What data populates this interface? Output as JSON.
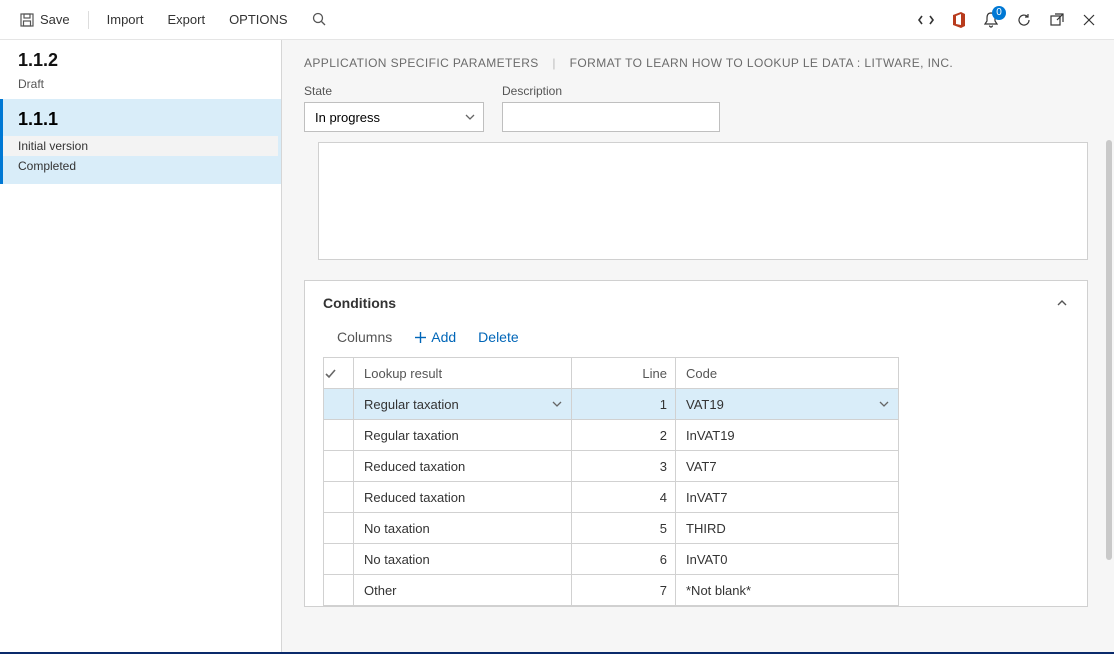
{
  "toolbar": {
    "save": "Save",
    "import": "Import",
    "export": "Export",
    "options": "OPTIONS"
  },
  "notification_count": "0",
  "sidebar": {
    "items": [
      {
        "version": "1.1.2",
        "status": "Draft"
      },
      {
        "version": "1.1.1",
        "desc": "Initial version",
        "status": "Completed"
      }
    ]
  },
  "breadcrumb": {
    "a": "APPLICATION SPECIFIC PARAMETERS",
    "b": "FORMAT TO LEARN HOW TO LOOKUP LE DATA : LITWARE, INC."
  },
  "form": {
    "state_label": "State",
    "state_value": "In progress",
    "desc_label": "Description",
    "desc_value": ""
  },
  "conditions": {
    "title": "Conditions",
    "columns_label": "Columns",
    "add_label": "Add",
    "delete_label": "Delete",
    "headers": {
      "lookup": "Lookup result",
      "line": "Line",
      "code": "Code"
    },
    "rows": [
      {
        "lookup": "Regular taxation",
        "line": "1",
        "code": "VAT19"
      },
      {
        "lookup": "Regular taxation",
        "line": "2",
        "code": "InVAT19"
      },
      {
        "lookup": "Reduced taxation",
        "line": "3",
        "code": "VAT7"
      },
      {
        "lookup": "Reduced taxation",
        "line": "4",
        "code": "InVAT7"
      },
      {
        "lookup": "No taxation",
        "line": "5",
        "code": "THIRD"
      },
      {
        "lookup": "No taxation",
        "line": "6",
        "code": "InVAT0"
      },
      {
        "lookup": "Other",
        "line": "7",
        "code": "*Not blank*"
      }
    ]
  }
}
